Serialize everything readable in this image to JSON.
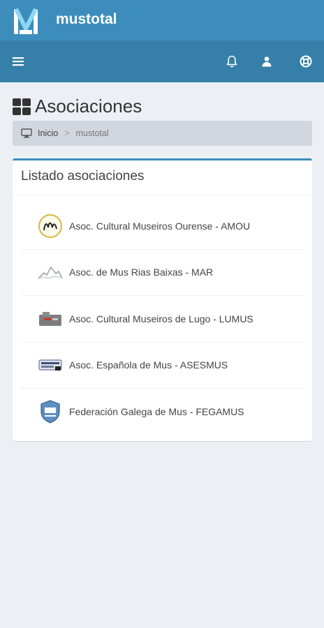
{
  "app": {
    "name": "mustotal"
  },
  "colors": {
    "header": "#3c8dbc",
    "navbar": "#367fa9",
    "background": "#ecf0f5",
    "breadcrumb": "#d2d6de"
  },
  "navbar": {
    "menu_icon": "hamburger-icon",
    "actions": [
      {
        "name": "notifications",
        "icon": "bell-icon"
      },
      {
        "name": "user",
        "icon": "user-icon"
      },
      {
        "name": "support",
        "icon": "lifebuoy-icon"
      }
    ]
  },
  "page": {
    "title": "Asociaciones",
    "icon": "grid-icon"
  },
  "breadcrumb": {
    "home": "Inicio",
    "separator": ">",
    "current": "mustotal"
  },
  "box": {
    "title": "Listado asociaciones",
    "items": [
      {
        "label": "Asoc. Cultural Museiros Ourense - AMOU"
      },
      {
        "label": "Asoc. de Mus Rias Baixas - MAR"
      },
      {
        "label": "Asoc. Cultural Museiros de Lugo - LUMUS"
      },
      {
        "label": "Asoc. Española de Mus - ASESMUS"
      },
      {
        "label": "Federación Galega de Mus - FEGAMUS"
      }
    ]
  }
}
